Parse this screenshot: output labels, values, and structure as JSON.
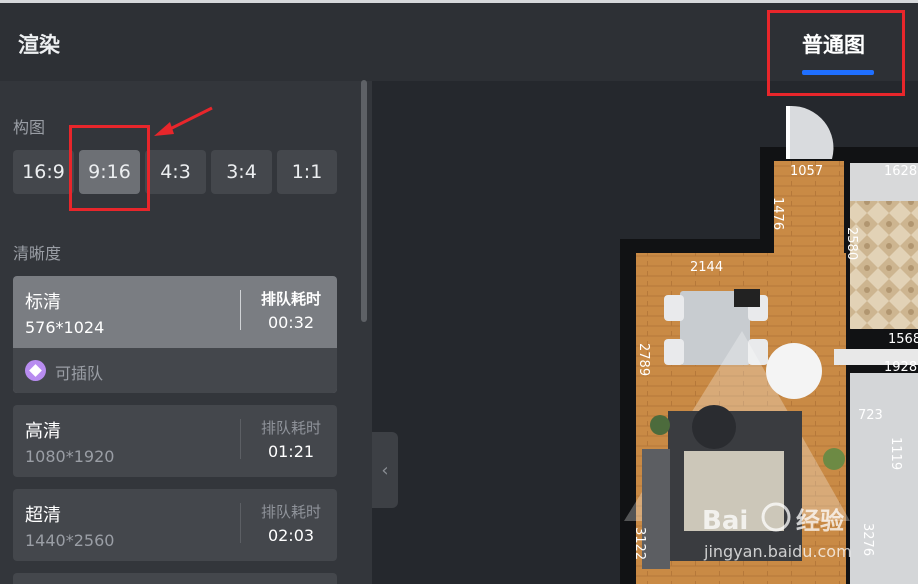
{
  "header": {
    "title": "渲染",
    "tab_normal": "普通图"
  },
  "composition": {
    "label": "构图",
    "ratios": [
      "16:9",
      "9:16",
      "4:3",
      "3:4",
      "1:1"
    ],
    "selected": "9:16"
  },
  "clarity": {
    "label": "清晰度",
    "options": [
      {
        "name": "标清",
        "size": "576*1024",
        "queue_label": "排队耗时",
        "queue_time": "00:32",
        "jump_label": "可插队"
      },
      {
        "name": "高清",
        "size": "1080*1920",
        "queue_label": "排队耗时",
        "queue_time": "01:21"
      },
      {
        "name": "超清",
        "size": "1440*2560",
        "queue_label": "排队耗时",
        "queue_time": "02:03"
      }
    ]
  },
  "floorplan": {
    "dimensions": [
      "1057",
      "1628",
      "1476",
      "2580",
      "2144",
      "1568",
      "2789",
      "1928",
      "723",
      "1119",
      "3122",
      "3276"
    ]
  },
  "watermark": {
    "brand": "Bai",
    "brand_cn": "经验",
    "url": "jingyan.baidu.com"
  },
  "colors": {
    "accent": "#1f6fff",
    "annotation": "#e8262b",
    "vip": "#b88cf0"
  }
}
